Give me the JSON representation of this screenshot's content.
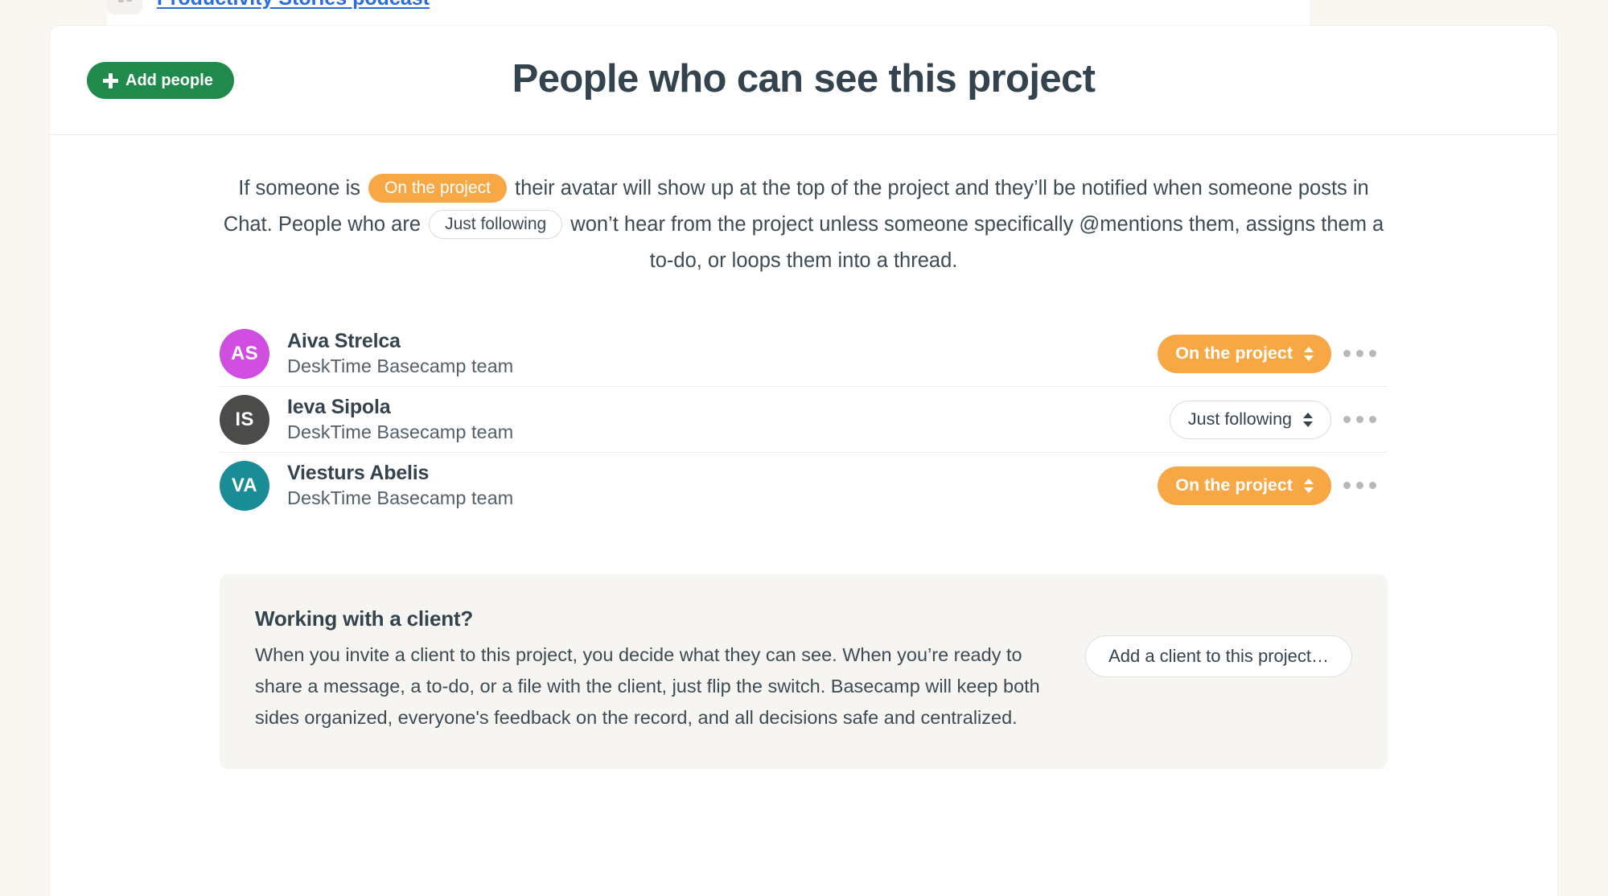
{
  "top_strip": {
    "link_label": "Productivity Stories podcast",
    "icon": "grid-icon"
  },
  "header": {
    "add_people_label": "Add people",
    "title": "People who can see this project"
  },
  "intro": {
    "part1": "If someone is",
    "badge_on": "On the project",
    "part2": "their avatar will show up at the top of the project and they’ll be notified when someone posts in Chat. People who are",
    "badge_following": "Just following",
    "part3": "won’t hear from the project unless someone specifically @mentions them, assigns them a to-do, or loops them into a thread."
  },
  "people": [
    {
      "initials": "AS",
      "name": "Aiva Strelca",
      "team": "DeskTime Basecamp team",
      "avatar_color": "#cf4ddf",
      "role": "On the project",
      "role_style": "on"
    },
    {
      "initials": "IS",
      "name": "Ieva Sipola",
      "team": "DeskTime Basecamp team",
      "avatar_color": "#4b4b49",
      "role": "Just following",
      "role_style": "following"
    },
    {
      "initials": "VA",
      "name": "Viesturs Abelis",
      "team": "DeskTime Basecamp team",
      "avatar_color": "#1a8c95",
      "role": "On the project",
      "role_style": "on"
    }
  ],
  "client_box": {
    "title": "Working with a client?",
    "body": "When you invite a client to this project, you decide what they can see. When you’re ready to share a message, a to-do, or a file with the client, just flip the switch. Basecamp will keep both sides organized, everyone's feedback on the record, and all decisions safe and centralized.",
    "button_label": "Add a client to this project…"
  },
  "colors": {
    "brand_green": "#1f8a4c",
    "accent_orange": "#f7a845",
    "link_blue": "#2a6ddb",
    "text_dark": "#33444e",
    "page_bg": "#faf6f1"
  }
}
